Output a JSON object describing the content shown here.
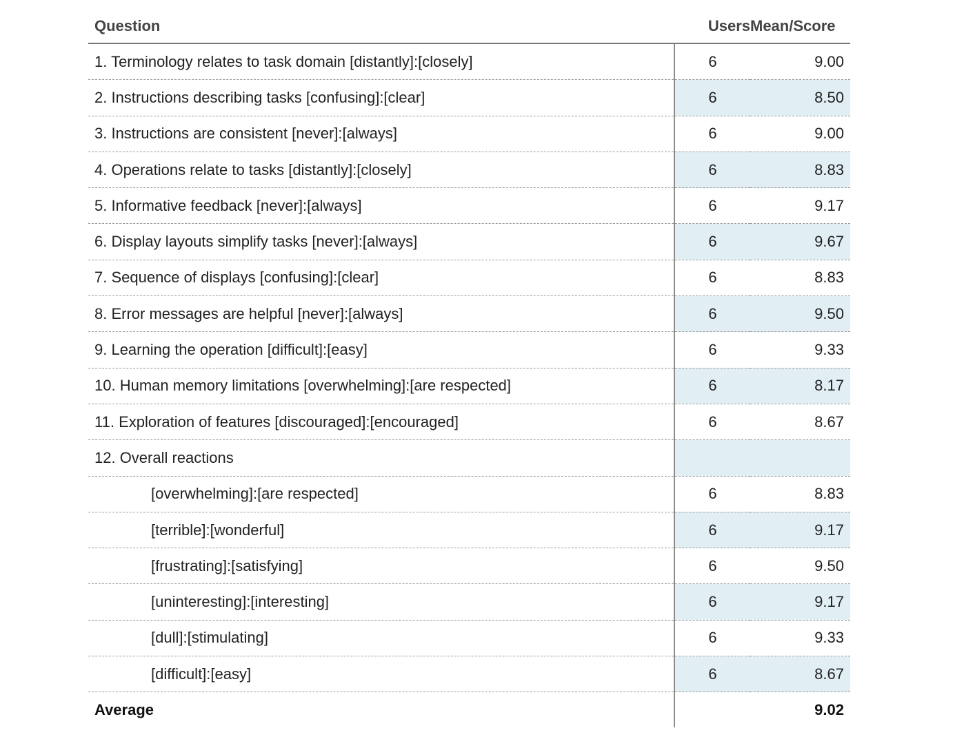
{
  "table": {
    "headers": {
      "question": "Question",
      "users": "Users",
      "score": "Mean/Score"
    },
    "rows": [
      {
        "question": "1. Terminology relates to task domain [distantly]:[closely]",
        "users": "6",
        "score": "9.00",
        "indent": false
      },
      {
        "question": "2. Instructions describing tasks [confusing]:[clear]",
        "users": "6",
        "score": "8.50",
        "indent": false
      },
      {
        "question": "3. Instructions are consistent [never]:[always]",
        "users": "6",
        "score": "9.00",
        "indent": false
      },
      {
        "question": "4. Operations relate to tasks [distantly]:[closely]",
        "users": "6",
        "score": "8.83",
        "indent": false
      },
      {
        "question": "5. Informative feedback [never]:[always]",
        "users": "6",
        "score": "9.17",
        "indent": false
      },
      {
        "question": "6. Display layouts simplify tasks [never]:[always]",
        "users": "6",
        "score": "9.67",
        "indent": false
      },
      {
        "question": "7. Sequence of displays [confusing]:[clear]",
        "users": "6",
        "score": "8.83",
        "indent": false
      },
      {
        "question": "8. Error messages are helpful [never]:[always]",
        "users": "6",
        "score": "9.50",
        "indent": false
      },
      {
        "question": "9. Learning the operation [difficult]:[easy]",
        "users": "6",
        "score": "9.33",
        "indent": false
      },
      {
        "question": "10. Human memory limitations [overwhelming]:[are respected]",
        "users": "6",
        "score": "8.17",
        "indent": false
      },
      {
        "question": "11. Exploration of features [discouraged]:[encouraged]",
        "users": "6",
        "score": "8.67",
        "indent": false
      },
      {
        "question": "12. Overall reactions",
        "users": "",
        "score": "",
        "indent": false
      },
      {
        "question": "[overwhelming]:[are respected]",
        "users": "6",
        "score": "8.83",
        "indent": true
      },
      {
        "question": "[terrible]:[wonderful]",
        "users": "6",
        "score": "9.17",
        "indent": true
      },
      {
        "question": "[frustrating]:[satisfying]",
        "users": "6",
        "score": "9.50",
        "indent": true
      },
      {
        "question": "[uninteresting]:[interesting]",
        "users": "6",
        "score": "9.17",
        "indent": true
      },
      {
        "question": "[dull]:[stimulating]",
        "users": "6",
        "score": "9.33",
        "indent": true
      },
      {
        "question": "[difficult]:[easy]",
        "users": "6",
        "score": "8.67",
        "indent": true
      }
    ],
    "footer": {
      "label": "Average",
      "users": "",
      "score": "9.02"
    },
    "colors": {
      "shade": "#e1eff5",
      "rule": "#777777",
      "dashed": "#9a9a9a"
    }
  }
}
